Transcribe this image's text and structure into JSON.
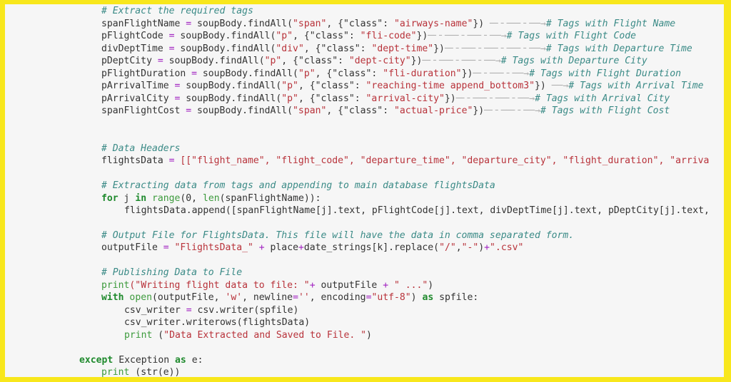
{
  "code": {
    "comment_extract": "# Extract the required tags",
    "tag_lines": [
      {
        "var": "spanFlightName",
        "tag": "\"span\"",
        "cls": "\"airways-name\"",
        "arrow": " ─╴╴──╴╴──→",
        "comment": "# Tags with Flight Name"
      },
      {
        "var": "pFlightCode",
        "tag": "\"p\"",
        "cls": "\"fli-code\"",
        "arrow": "─╴╴──╴╴──╴╴──→",
        "comment": "# Tags with Flight Code"
      },
      {
        "var": "divDeptTime",
        "tag": "\"div\"",
        "cls": "\"dept-time\"",
        "arrow": "─╴╴──╴╴──╴╴──╴╴──→",
        "comment": "# Tags with Departure Time"
      },
      {
        "var": "pDeptCity",
        "tag": "\"p\"",
        "cls": "\"dept-city\"",
        "arrow": "─╴╴──╴╴──╴╴──→",
        "comment": "# Tags with Departure City"
      },
      {
        "var": "pFlightDuration",
        "tag": "\"p\"",
        "cls": "\"fli-duration\"",
        "arrow": "─╴╴──╴╴──→",
        "comment": "# Tags with Flight Duration"
      },
      {
        "var": "pArrivalTime",
        "tag": "\"p\"",
        "cls": "\"reaching-time append_bottom3\"",
        "arrow": " ──→",
        "comment": "# Tags with Arrival Time"
      },
      {
        "var": "pArrivalCity",
        "tag": "\"p\"",
        "cls": "\"arrival-city\"",
        "arrow": "─╴╴──╴╴──╴╴──→",
        "comment": "# Tags with Arrival City"
      },
      {
        "var": "spanFlightCost",
        "tag": "\"span\"",
        "cls": "\"actual-price\"",
        "arrow": "─╴╴──╴╴──→",
        "comment": "# Tags with Flight Cost"
      }
    ],
    "comment_headers": "# Data Headers",
    "headers_line": {
      "var": "flightsData",
      "values": "[[\"flight_name\", \"flight_code\", \"departure_time\", \"departure_city\", \"flight_duration\", \"arriva"
    },
    "comment_extracting": "# Extracting data from tags and appending to main database flightsData",
    "for_line": {
      "kw_for": "for",
      "rest1": " j ",
      "kw_in": "in",
      "fn_range": " range",
      "rest2": "(0, ",
      "fn_len": "len",
      "rest3": "(spanFlightName)):"
    },
    "append_line": "flightsData.append([spanFlightName[j].text, pFlightCode[j].text, divDeptTime[j].text, pDeptCity[j].text,",
    "comment_output": "# Output File for FlightsData. This file will have the data in comma separated form.",
    "output_line": {
      "var": "outputFile ",
      "s1": "\"FlightsData_\"",
      "mid": " place",
      "mid2": "date_strings[k].replace(",
      "s2": "\"/\"",
      "comma": ",",
      "s3": "\"-\"",
      "close": ")",
      "s4": "\".csv\""
    },
    "comment_publishing": "# Publishing Data to File",
    "print_line": {
      "fn": "print",
      "s1": "(\"Writing flight data to file: \"",
      "mid": " outputFile ",
      "s2": " \" ...\"",
      "close": ")"
    },
    "with_line": {
      "kw": "with",
      "fn": " open",
      "a": "(outputFile, ",
      "s1": "'w'",
      "b": ", newline",
      "s2": "''",
      "c": ", encoding",
      "s3": "\"utf-8\"",
      "d": ") ",
      "kw_as": "as",
      "e": " spfile:"
    },
    "csv_line1": {
      "a": "csv_writer ",
      "b": " csv.writer(spfile)"
    },
    "csv_line2": "csv_writer.writerows(flightsData)",
    "print2_line": {
      "fn": "print",
      "a": " (",
      "s": "\"Data Extracted and Saved to File. \"",
      "b": ")"
    },
    "except_line": {
      "kw": "except",
      "a": " Exception ",
      "kw_as": "as",
      "b": " e:"
    },
    "print3_line": {
      "fn": "print",
      "a": " (str(e))"
    },
    "ops": {
      "eq": "=",
      "plus": "+"
    },
    "find_prefix": "soupBody.findAll(",
    "class_key": "{\"class\": ",
    "find_suffix": "})"
  }
}
